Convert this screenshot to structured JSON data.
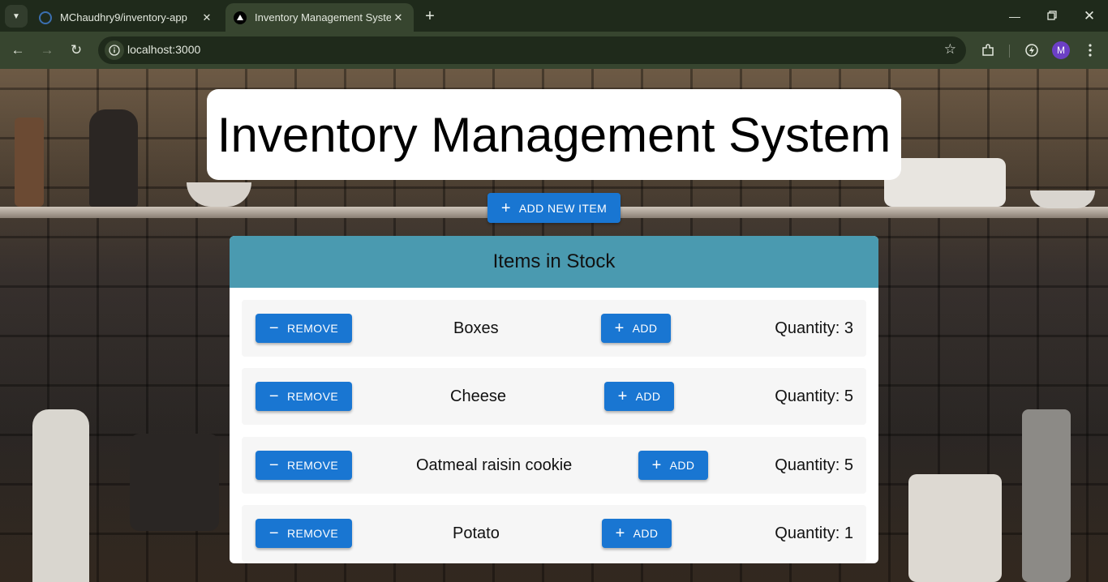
{
  "browser": {
    "tabs": [
      {
        "title": "MChaudhry9/inventory-app",
        "icon": "github-icon",
        "active": false
      },
      {
        "title": "Inventory Management System",
        "icon": "triangle-logo-icon",
        "active": true
      }
    ],
    "url": "localhost:3000",
    "profile_initial": "M"
  },
  "page": {
    "title": "Inventory Management System",
    "add_new_label": "ADD NEW ITEM",
    "stock_heading": "Items in Stock",
    "remove_label": "REMOVE",
    "add_label": "ADD",
    "items": [
      {
        "name": "Boxes",
        "quantity": "Quantity: 3"
      },
      {
        "name": "Cheese",
        "quantity": "Quantity: 5"
      },
      {
        "name": "Oatmeal raisin cookie",
        "quantity": "Quantity: 5"
      },
      {
        "name": "Potato",
        "quantity": "Quantity: 1"
      }
    ]
  },
  "colors": {
    "primary_button": "#1976d2",
    "panel_header": "#4a9ab0",
    "browser_frame": "#37452f"
  }
}
